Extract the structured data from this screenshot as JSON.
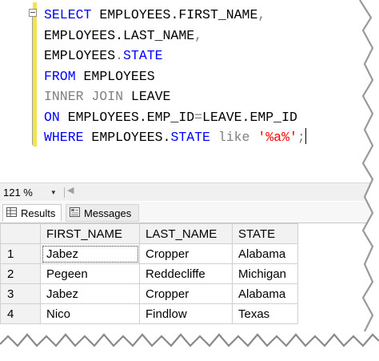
{
  "editor": {
    "lines": [
      [
        {
          "t": "SELECT",
          "c": "kw"
        },
        {
          "t": " EMPLOYEES.FIRST_NAME",
          "c": ""
        },
        {
          "t": ",",
          "c": "gray"
        }
      ],
      [
        {
          "t": "EMPLOYEES.LAST_NAME",
          "c": ""
        },
        {
          "t": ",",
          "c": "gray"
        }
      ],
      [
        {
          "t": "EMPLOYEES",
          "c": ""
        },
        {
          "t": ".",
          "c": "gray"
        },
        {
          "t": "STATE",
          "c": "kw"
        }
      ],
      [
        {
          "t": "FROM",
          "c": "kw"
        },
        {
          "t": " EMPLOYEES",
          "c": ""
        }
      ],
      [
        {
          "t": "INNER JOIN",
          "c": "gray"
        },
        {
          "t": " LEAVE",
          "c": ""
        }
      ],
      [
        {
          "t": "ON",
          "c": "kw"
        },
        {
          "t": " EMPLOYEES.EMP_ID",
          "c": ""
        },
        {
          "t": "=",
          "c": "gray"
        },
        {
          "t": "LEAVE.EMP_ID",
          "c": ""
        }
      ],
      [
        {
          "t": "WHERE",
          "c": "kw"
        },
        {
          "t": " EMPLOYEES.",
          "c": ""
        },
        {
          "t": "STATE",
          "c": "kw"
        },
        {
          "t": " like ",
          "c": "gray"
        },
        {
          "t": "'%a%'",
          "c": "str"
        },
        {
          "t": ";",
          "c": "gray"
        }
      ]
    ]
  },
  "zoom": {
    "value": "121 %"
  },
  "tabs": {
    "results": "Results",
    "messages": "Messages"
  },
  "grid": {
    "columns": [
      "FIRST_NAME",
      "LAST_NAME",
      "STATE"
    ],
    "rows": [
      {
        "n": "1",
        "cells": [
          "Jabez",
          "Cropper",
          "Alabama"
        ]
      },
      {
        "n": "2",
        "cells": [
          "Pegeen",
          "Reddecliffe",
          "Michigan"
        ]
      },
      {
        "n": "3",
        "cells": [
          "Jabez",
          "Cropper",
          "Alabama"
        ]
      },
      {
        "n": "4",
        "cells": [
          "Nico",
          "Findlow",
          "Texas"
        ]
      }
    ]
  },
  "icons": {
    "results": "grid-icon",
    "messages": "messages-icon",
    "zoom_dropdown": "chevron-down-icon"
  }
}
